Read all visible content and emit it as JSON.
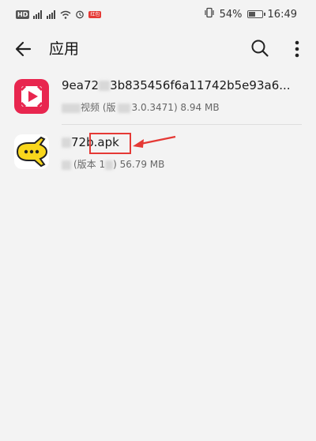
{
  "status_bar": {
    "hd": "HD",
    "sim1": "4G",
    "sim2": "4G",
    "notification_badge": "红包",
    "battery_percent": "54%",
    "battery_level": 0.54,
    "time": "16:49"
  },
  "app_bar": {
    "title": "应用"
  },
  "items": [
    {
      "title_pre": "9ea72",
      "title_post": "3b835456f6a11742b5e93a6...",
      "sub_pre": "",
      "sub_mid": "视频 (版",
      "sub_post": "3.0.3471) 8.94 MB",
      "icon": "video-app-icon",
      "icon_color": "#e8264f"
    },
    {
      "title_pre": "",
      "title_post": "72b.apk",
      "sub_pre": "",
      "sub_mid": "(版本 1",
      "sub_post": ") 56.79 MB",
      "icon": "plane-app-icon",
      "icon_color": "#f9d71c"
    }
  ],
  "annotation": {
    "box_color": "#e53935"
  }
}
